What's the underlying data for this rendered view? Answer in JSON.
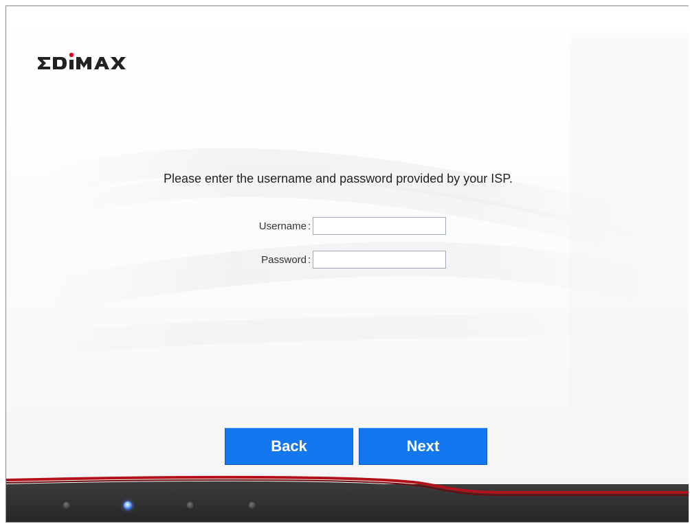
{
  "brand": {
    "logo_text": "EDIMAX",
    "accent_color": "#e0001b"
  },
  "form": {
    "prompt": "Please enter the username and password provided by your ISP.",
    "username": {
      "label": "Username",
      "separator": ":",
      "value": ""
    },
    "password": {
      "label": "Password",
      "separator": ":",
      "value": ""
    }
  },
  "buttons": {
    "back_label": "Back",
    "next_label": "Next",
    "color": "#1377f0"
  },
  "progress": {
    "step_count": 4,
    "active_step": 2
  },
  "colors": {
    "bottom_bar": "#2e2e2e",
    "bottom_accent": "#b3121a"
  }
}
